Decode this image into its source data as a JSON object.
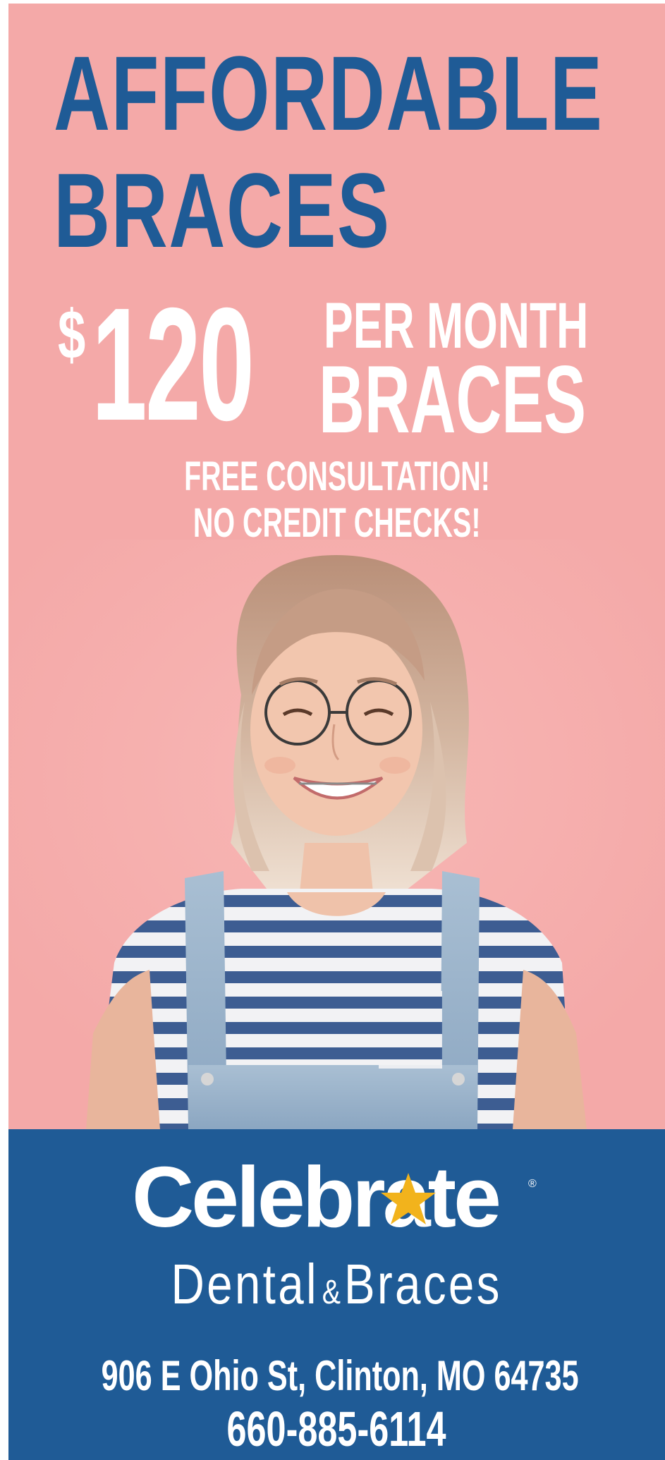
{
  "ad": {
    "headline_line1": "AFFORDABLE",
    "headline_line2": "BRACES",
    "price_symbol": "$",
    "price_amount": "120",
    "price_period": "PER MONTH",
    "price_product": "BRACES",
    "promo_line1": "FREE CONSULTATION!",
    "promo_line2": "NO CREDIT CHECKS!"
  },
  "brand": {
    "logo_text": "Celebrate",
    "registered_mark": "®",
    "tagline_part1": "Dental",
    "tagline_amp": "&",
    "tagline_part2": "Braces",
    "logo_icon": "star-icon"
  },
  "contact": {
    "address": "906 E Ohio St, Clinton, MO 64735",
    "phone": "660-885-6114"
  },
  "colors": {
    "background_pink": "#f4a9a8",
    "brand_blue": "#1f5b96",
    "star_gold": "#f2b31c",
    "text_white": "#ffffff"
  }
}
